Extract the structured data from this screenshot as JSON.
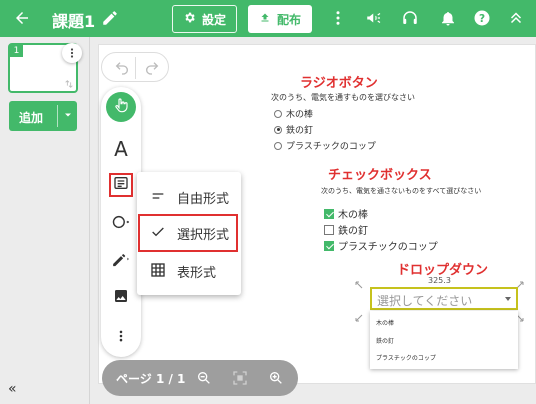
{
  "header": {
    "title": "課題1",
    "settings_label": "設定",
    "publish_label": "配布"
  },
  "sidebar": {
    "slide_number": "1",
    "add_label": "追加",
    "collapse_label": "«"
  },
  "toolbar": {
    "text_tool": "A"
  },
  "popup_menu": {
    "items": [
      {
        "label": "自由形式",
        "icon": "short-text-icon"
      },
      {
        "label": "選択形式",
        "icon": "check-icon"
      },
      {
        "label": "表形式",
        "icon": "table-icon"
      }
    ]
  },
  "bottom_bar": {
    "page_label": "ページ 1 / 1"
  },
  "content": {
    "radio": {
      "heading": "ラジオボタン",
      "instruction": "次のうち、電気を通すものを選びなさい",
      "options": [
        "木の棒",
        "鉄の釘",
        "プラスチックのコップ"
      ],
      "selected_index": 1
    },
    "checkbox": {
      "heading": "チェックボックス",
      "instruction": "次のうち、電気を通さないものをすべて選びなさい",
      "options": [
        "木の棒",
        "鉄の釘",
        "プラスチックのコップ"
      ],
      "checked": [
        true,
        false,
        true
      ]
    },
    "dropdown": {
      "heading": "ドロップダウン",
      "width_readout": "325.3",
      "placeholder": "選択してください",
      "options": [
        "木の棒",
        "鉄の釘",
        "プラスチックのコップ"
      ]
    }
  },
  "colors": {
    "brand_green": "#43b96a",
    "highlight_red": "#e03030",
    "selection_yellow": "#c6c21d"
  }
}
